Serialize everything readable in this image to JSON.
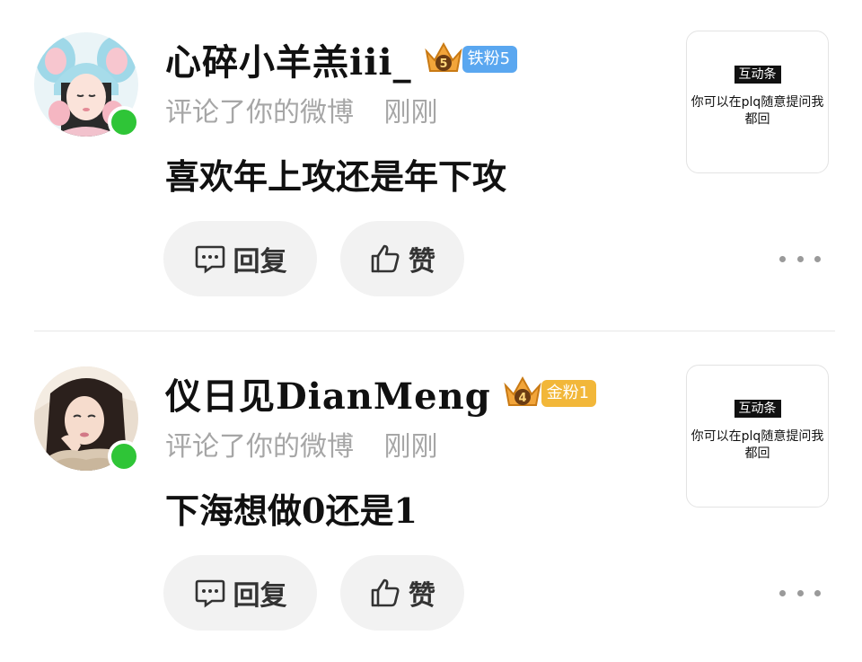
{
  "notifications": [
    {
      "username": "心碎小羊羔iii_",
      "badge": {
        "level_label": "铁粉5",
        "color": "#5aa7f0",
        "crown_number": "5"
      },
      "action_text": "评论了你的微博",
      "time": "刚刚",
      "comment": "喜欢年上攻还是年下攻",
      "reply_label": "回复",
      "like_label": "赞",
      "thumbnail": {
        "tag": "互动条",
        "text": "你可以在plq随意提问我都回"
      },
      "online": true
    },
    {
      "username": "仪日见DianMeng",
      "badge": {
        "level_label": "金粉1",
        "color": "#f2b739",
        "crown_number": "4"
      },
      "action_text": "评论了你的微博",
      "time": "刚刚",
      "comment": "下海想做0还是1",
      "reply_label": "回复",
      "like_label": "赞",
      "thumbnail": {
        "tag": "互动条",
        "text": "你可以在plq随意提问我都回"
      },
      "online": true
    }
  ],
  "colors": {
    "online": "#2fc537",
    "meta_text": "#a6a6a6",
    "button_bg": "#f2f2f2"
  },
  "icons": {
    "reply": "comment-bubble-icon",
    "like": "thumbs-up-icon",
    "more": "more-dots-icon",
    "crown": "crown-icon"
  }
}
